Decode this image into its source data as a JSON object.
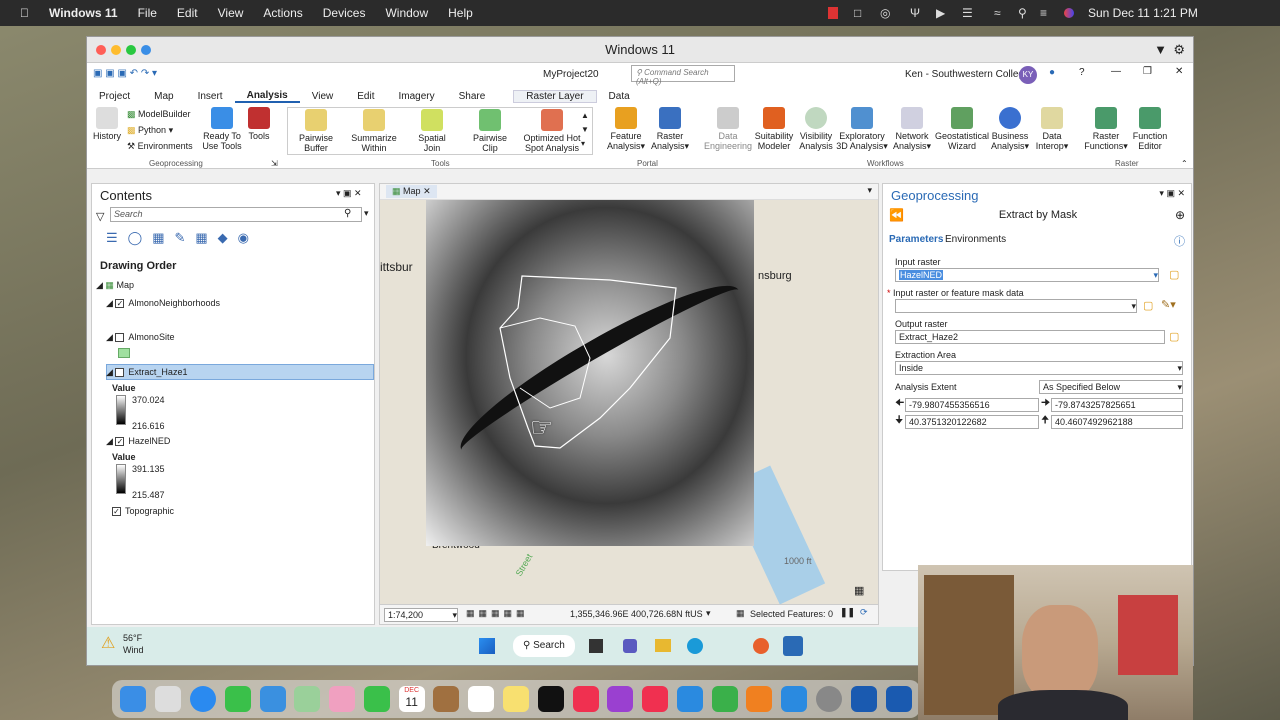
{
  "mac": {
    "app": "Windows 11",
    "menus": [
      "File",
      "Edit",
      "View",
      "Actions",
      "Devices",
      "Window",
      "Help"
    ],
    "clock": "Sun Dec 11  1:21 PM"
  },
  "vm": {
    "title": "Windows 11"
  },
  "pro": {
    "project": "MyProject20",
    "command_search": "Command Search (Alt+Q)",
    "user": "Ken - Southwestern College",
    "user_initials": "KY",
    "tabs": [
      "Project",
      "Map",
      "Insert",
      "Analysis",
      "View",
      "Edit",
      "Imagery",
      "Share"
    ],
    "context_tab": "Raster Layer",
    "context_tab2": "Data"
  },
  "ribbon": {
    "history": "History",
    "modelbuilder": "ModelBuilder",
    "python": "Python",
    "environments": "Environments",
    "ready": "Ready To Use Tools",
    "tools": "Tools",
    "geoprocessing": "Geoprocessing",
    "gallery": [
      {
        "l1": "Pairwise",
        "l2": "Buffer"
      },
      {
        "l1": "Summarize",
        "l2": "Within"
      },
      {
        "l1": "Spatial",
        "l2": "Join"
      },
      {
        "l1": "Pairwise",
        "l2": "Clip"
      },
      {
        "l1": "Optimized Hot",
        "l2": "Spot Analysis"
      }
    ],
    "tools_group": "Tools",
    "portal": [
      {
        "l1": "Feature",
        "l2": "Analysis"
      },
      {
        "l1": "Raster",
        "l2": "Analysis"
      }
    ],
    "portal_group": "Portal",
    "workflows": [
      {
        "l1": "Data",
        "l2": "Engineering"
      },
      {
        "l1": "Suitability",
        "l2": "Modeler"
      },
      {
        "l1": "Visibility",
        "l2": "Analysis"
      },
      {
        "l1": "Exploratory",
        "l2": "3D Analysis"
      },
      {
        "l1": "Network",
        "l2": "Analysis"
      },
      {
        "l1": "Geostatistical",
        "l2": "Wizard"
      },
      {
        "l1": "Business",
        "l2": "Analysis"
      },
      {
        "l1": "Data",
        "l2": "Interop"
      }
    ],
    "workflows_group": "Workflows",
    "raster": [
      {
        "l1": "Raster",
        "l2": "Functions"
      },
      {
        "l1": "Function",
        "l2": "Editor"
      }
    ],
    "raster_group": "Raster"
  },
  "contents": {
    "title": "Contents",
    "search_placeholder": "Search",
    "drawing_order": "Drawing Order",
    "map": "Map",
    "layers": {
      "almono_neigh": "AlmonoNeighborhoods",
      "almono_site": "AlmonoSite",
      "extract": "Extract_Haze1",
      "extract_value": "Value",
      "extract_high": "370.024",
      "extract_low": "216.616",
      "hazel": "HazelNED",
      "hazel_value": "Value",
      "hazel_high": "391.135",
      "hazel_low": "215.487",
      "topo": "Topographic"
    }
  },
  "map": {
    "tab": "Map",
    "labels": {
      "pittsburgh": "ittsbur",
      "burg": "nsburg",
      "brentwood": "Brentwood",
      "street": "Street",
      "contour": "1000 ft"
    },
    "scale": "1:74,200",
    "coords": "1,355,346.96E 400,726.68N ftUS",
    "selected": "Selected Features: 0"
  },
  "geo": {
    "title": "Geoprocessing",
    "tool": "Extract by Mask",
    "tab_params": "Parameters",
    "tab_env": "Environments",
    "input_raster_label": "Input raster",
    "input_raster": "HazelNED",
    "mask_label": "Input raster or feature mask data",
    "output_label": "Output raster",
    "output": "Extract_Haze2",
    "area_label": "Extraction Area",
    "area": "Inside",
    "extent_label": "Analysis Extent",
    "extent_mode": "As Specified Below",
    "left": "-79.9807455356516",
    "right": "-79.8743257825651",
    "bottom": "40.3751320122682",
    "top": "40.4607492962188"
  },
  "taskbar": {
    "temp": "56°F",
    "weather": "Wind",
    "search": "Search"
  },
  "dock": {
    "calendar_month": "DEC",
    "calendar_day": "11"
  }
}
